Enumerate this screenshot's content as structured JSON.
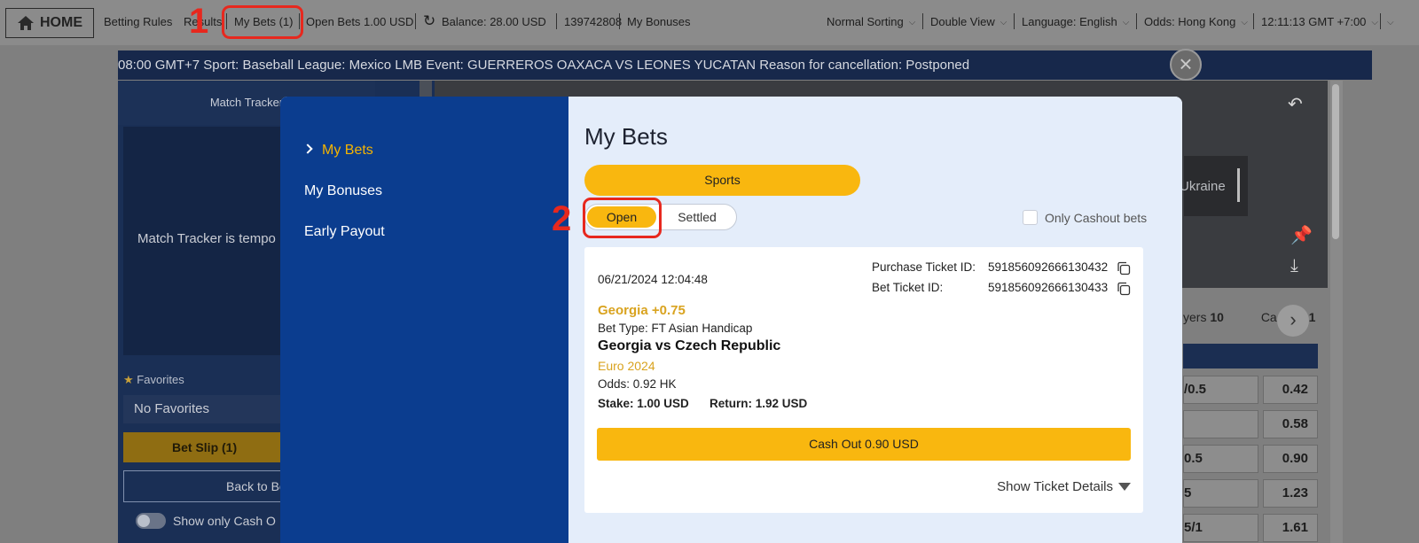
{
  "topbar": {
    "home": "HOME",
    "betting_rules": "Betting Rules",
    "results": "Results",
    "my_bets": "My Bets (1)",
    "open_bets": "Open Bets 1.00 USD",
    "balance": "Balance: 28.00 USD",
    "account_id": "139742808",
    "my_bonuses": "My Bonuses",
    "sorting": "Normal Sorting",
    "view": "Double View",
    "language": "Language: English",
    "odds_format": "Odds: Hong Kong",
    "time": "12:11:13 GMT +7:00"
  },
  "annotations": {
    "step1": "1",
    "step2": "2"
  },
  "ticker": "08:00 GMT+7 Sport: Baseball League: Mexico LMB Event: GUERREROS OAXACA VS LEONES YUCATAN Reason for cancellation: Postponed",
  "left_panel": {
    "match_tracker_title": "Match Tracker",
    "match_tracker_msg": "Match Tracker is tempo",
    "favorites_label": "Favorites",
    "no_favorites": "No Favorites",
    "bet_slip": "Bet Slip (1)",
    "back_to": "Back to Be",
    "show_cash_only": "Show only Cash O"
  },
  "background": {
    "video_team": "Ukraine",
    "stats_players": "yers",
    "stats_players_num": "10",
    "stats_ca": "Ca",
    "stats_ca_num": "1",
    "odds_rows": [
      {
        "handicap": "/0.5",
        "odds": "0.42"
      },
      {
        "handicap": "",
        "odds": "0.58"
      },
      {
        "handicap": "0.5",
        "odds": "0.90"
      },
      {
        "handicap": "5",
        "odds": "1.23"
      },
      {
        "handicap": "5/1",
        "odds": "1.61"
      }
    ]
  },
  "modal": {
    "nav": {
      "my_bets": "My Bets",
      "my_bonuses": "My Bonuses",
      "early_payout": "Early Payout"
    },
    "title": "My Bets",
    "sports": "Sports",
    "tab_open": "Open",
    "tab_settled": "Settled",
    "only_cashout": "Only Cashout bets",
    "ticket": {
      "datetime": "06/21/2024 12:04:48",
      "purchase_label": "Purchase Ticket ID:",
      "purchase_id": "591856092666130432",
      "bet_label": "Bet Ticket ID:",
      "bet_id": "591856092666130433",
      "selection": "Georgia +0.75",
      "bet_type": "Bet Type: FT Asian Handicap",
      "match": "Georgia vs Czech Republic",
      "league": "Euro 2024",
      "odds": "Odds: 0.92 HK",
      "stake": "Stake: 1.00 USD",
      "return": "Return: 1.92 USD",
      "cash_out": "Cash Out 0.90 USD",
      "show_details": "Show Ticket Details"
    }
  },
  "colors": {
    "accent": "#f9b70f",
    "nav_blue": "#0b3d8f",
    "highlight_red": "#e7281e",
    "selection_gold": "#d9a31f"
  }
}
